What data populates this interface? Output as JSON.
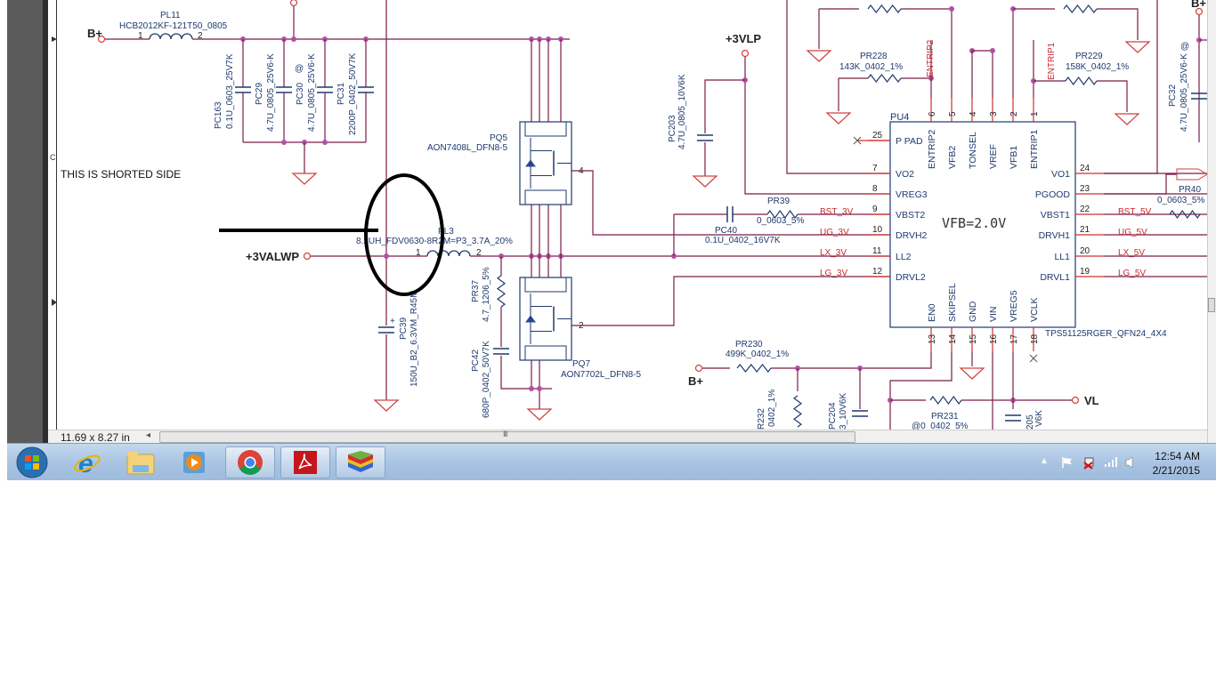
{
  "viewer": {
    "page_size": "11.69 x 8.27 in",
    "scroll_grip": "III",
    "margin_letter": "C",
    "scroll_left_arrow": "◂"
  },
  "annotation": {
    "note": "THIS IS SHORTED SIDE",
    "marker": "ellipse-and-arrow",
    "marker_color": "#000000"
  },
  "colors": {
    "wire": "#7a1c48",
    "pin_stub": "#d0302f",
    "text": "#1f3a6e",
    "net_label": "#c8282d",
    "junction": "#b250a8"
  },
  "nets": {
    "bplus": "B+",
    "v3valwp": "+3VALWP",
    "v3vlp": "+3VLP",
    "vl": "VL",
    "bst3": "BST_3V",
    "ug3": "UG_3V",
    "lx3": "LX_3V",
    "lg3": "LG_3V",
    "bst5": "BST_5V",
    "ug5": "UG_5V",
    "lx5": "LX_5V",
    "lg5": "LG_5V",
    "entrip2": "ENTRIP2",
    "entrip1": "ENTRIP1"
  },
  "components": {
    "pl11": {
      "ref": "PL11",
      "value": "HCB2012KF-121T50_0805"
    },
    "pc163": {
      "ref": "PC163",
      "value": "0.1U_0603_25V7K"
    },
    "pc29": {
      "ref": "PC29",
      "value": "4.7U_0805_25V6-K"
    },
    "pc30": {
      "ref": "PC30",
      "value": "4.7U_0805_25V6-K",
      "mark": "@"
    },
    "pc31": {
      "ref": "PC31",
      "value": "2200P_0402_50V7K"
    },
    "pl3": {
      "ref": "PL3",
      "value": "8.2UH_FDV0630-8R2M=P3_3.7A_20%"
    },
    "pc39": {
      "ref": "PC39",
      "value": "150U_B2_6.3VM_R45M",
      "polarity": "+"
    },
    "pq5": {
      "ref": "PQ5",
      "value": "AON7408L_DFN8-5"
    },
    "pq7": {
      "ref": "PQ7",
      "value": "AON7702L_DFN8-5"
    },
    "pr37": {
      "ref": "PR37",
      "value": "4.7_1206_5%"
    },
    "pc42": {
      "ref": "PC42",
      "value": "680P_0402_50V7K"
    },
    "pc203": {
      "ref": "PC203",
      "value": "4.7U_0805_10V6K"
    },
    "pr39": {
      "ref": "PR39",
      "value": "0_0603_5%"
    },
    "pc40": {
      "ref": "PC40",
      "value": "0.1U_0402_16V7K"
    },
    "pr228": {
      "ref": "PR228",
      "value": "143K_0402_1%"
    },
    "pr229": {
      "ref": "PR229",
      "value": "158K_0402_1%"
    },
    "pc32": {
      "ref": "PC32",
      "value": "4.7U_0805_25V6-K",
      "mark": "@"
    },
    "pr40": {
      "ref": "PR40",
      "value": "0_0603_5%"
    },
    "pr230": {
      "ref": "PR230",
      "value": "499K_0402_1%"
    },
    "pr232": {
      "ref": "R232",
      "value": "0402_1%"
    },
    "pc204": {
      "ref": "PC204",
      "value": "3_10V6K"
    },
    "pr231": {
      "ref": "PR231",
      "value": "@0_0402_5%"
    },
    "pc205": {
      "ref": "205",
      "value": "V6K"
    }
  },
  "pu4": {
    "ref": "PU4",
    "part": "TPS51125RGER_QFN24_4X4",
    "note": "VFB=2.0V",
    "left_pins": [
      {
        "num": "25",
        "name": "P PAD"
      },
      {
        "num": "7",
        "name": "VO2"
      },
      {
        "num": "8",
        "name": "VREG3"
      },
      {
        "num": "9",
        "name": "VBST2"
      },
      {
        "num": "10",
        "name": "DRVH2"
      },
      {
        "num": "11",
        "name": "LL2"
      },
      {
        "num": "12",
        "name": "DRVL2"
      }
    ],
    "right_pins": [
      {
        "num": "24",
        "name": "VO1"
      },
      {
        "num": "23",
        "name": "PGOOD"
      },
      {
        "num": "22",
        "name": "VBST1"
      },
      {
        "num": "21",
        "name": "DRVH1"
      },
      {
        "num": "20",
        "name": "LL1"
      },
      {
        "num": "19",
        "name": "DRVL1"
      }
    ],
    "top_pins": [
      {
        "num": "6",
        "name": "ENTRIP2"
      },
      {
        "num": "5",
        "name": "VFB2"
      },
      {
        "num": "4",
        "name": "TONSEL"
      },
      {
        "num": "3",
        "name": "VREF"
      },
      {
        "num": "2",
        "name": "VFB1"
      },
      {
        "num": "1",
        "name": "ENTRIP1"
      }
    ],
    "bottom_pins": [
      {
        "num": "13",
        "name": "EN0"
      },
      {
        "num": "14",
        "name": "SKIPSEL"
      },
      {
        "num": "15",
        "name": "GND"
      },
      {
        "num": "16",
        "name": "VIN"
      },
      {
        "num": "17",
        "name": "VREG5"
      },
      {
        "num": "18",
        "name": "VCLK"
      }
    ]
  },
  "pin_numbers": {
    "one": "1",
    "two": "2",
    "three": "3",
    "four": "4",
    "five": "5"
  },
  "taskbar": {
    "apps": [
      {
        "name": "start-button",
        "icon": "windows-orb-icon"
      },
      {
        "name": "internet-explorer",
        "icon": "ie-icon"
      },
      {
        "name": "windows-explorer",
        "icon": "folder-icon"
      },
      {
        "name": "media-player",
        "icon": "media-player-icon"
      },
      {
        "name": "google-chrome",
        "icon": "chrome-icon"
      },
      {
        "name": "adobe-reader",
        "icon": "acrobat-icon"
      },
      {
        "name": "bluestacks",
        "icon": "bluestacks-icon"
      }
    ],
    "tray_icons": [
      "show-hidden-icons-icon",
      "action-center-flag-icon",
      "power-plug-icon",
      "network-signal-icon",
      "volume-icon"
    ],
    "time": "12:54 AM",
    "date": "2/21/2015"
  }
}
